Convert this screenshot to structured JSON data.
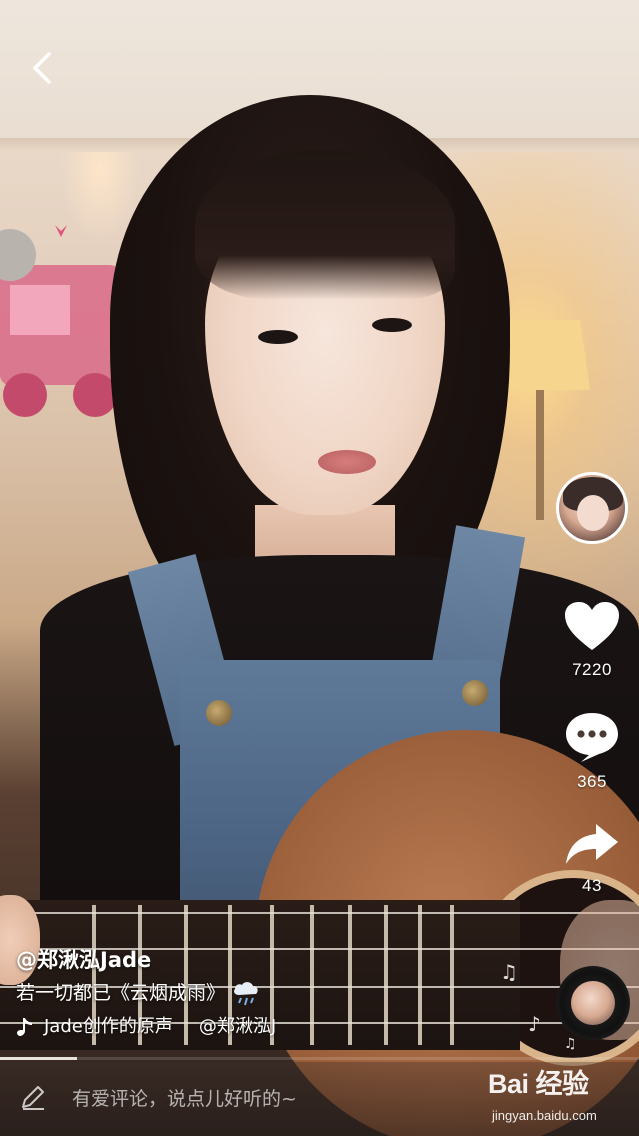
{
  "video": {
    "author_handle": "@郑湫泓Jade",
    "description": "若一切都已《云烟成雨》",
    "music_title": "Jade创作的原声",
    "music_owner": "@郑湫泓J",
    "progress_percent": 12
  },
  "actions": {
    "like_count": "7220",
    "comment_count": "365",
    "share_count": "43"
  },
  "comment_bar": {
    "placeholder": "有爱评论，说点儿好听的~"
  },
  "icons": {
    "back": "chevron-left-icon",
    "like": "heart-icon",
    "comment": "speech-bubble-icon",
    "share": "share-arrow-icon",
    "music": "music-note-icon",
    "edit": "pencil-icon",
    "weather": "rain-cloud-icon"
  },
  "colors": {
    "overlay_text": "#ffffff",
    "progress": "#e8e3dd"
  },
  "watermark": {
    "brand": "Bai 经验",
    "sub": "jingyan.baidu.com"
  }
}
